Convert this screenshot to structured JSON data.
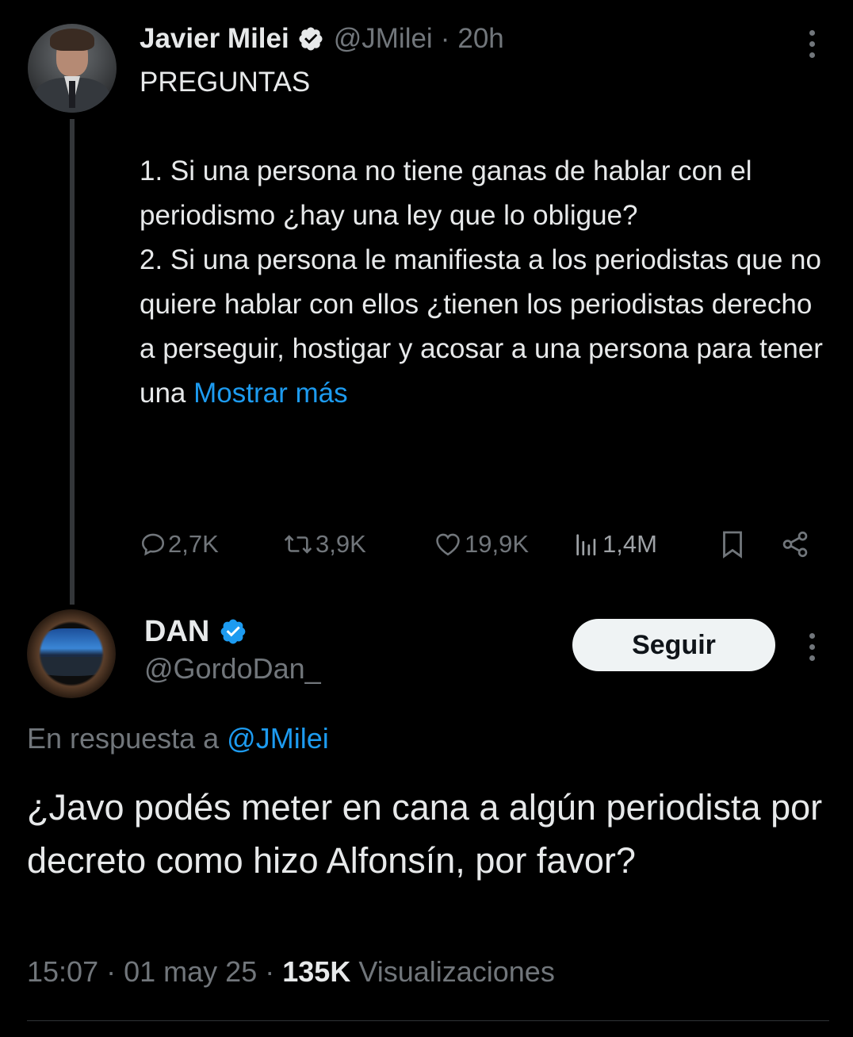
{
  "parent_tweet": {
    "author_name": "Javier Milei",
    "author_handle": "@JMilei",
    "separator": "·",
    "time_ago": "20h",
    "text_lines": [
      "PREGUNTAS",
      "",
      "1. Si una persona no tiene ganas de hablar con el periodismo ¿hay una ley que lo obligue?",
      "2. Si una persona le manifiesta a los periodistas que no quiere hablar con ellos ¿tienen los periodistas derecho a perseguir, hostigar y acosar a una persona para tener una"
    ],
    "show_more_label": "Mostrar más",
    "stats": {
      "replies": "2,7K",
      "retweets": "3,9K",
      "likes": "19,9K",
      "views": "1,4M"
    }
  },
  "reply_tweet": {
    "author_name": "DAN",
    "author_handle": "@GordoDan_",
    "follow_label": "Seguir",
    "in_reply_prefix": "En respuesta a",
    "in_reply_handle": "@JMilei",
    "text": "¿Javo podés meter en cana a algún periodista por decreto como hizo Alfonsín, por favor?",
    "time": "15:07",
    "date": "01 may 25",
    "separator": "·",
    "views_count": "135K",
    "views_label": "Visualizaciones"
  },
  "icons": {
    "verified": "verified-badge-icon",
    "more": "more-options-icon",
    "reply": "reply-icon",
    "retweet": "retweet-icon",
    "like": "heart-icon",
    "views": "views-icon",
    "bookmark": "bookmark-icon",
    "share": "share-icon"
  },
  "colors": {
    "background": "#000000",
    "text": "#e7e9ea",
    "muted": "#71767b",
    "link": "#1d9bf0",
    "verified": "#1d9bf0",
    "follow_button_bg": "#eff3f4",
    "follow_button_text": "#0f1419"
  }
}
